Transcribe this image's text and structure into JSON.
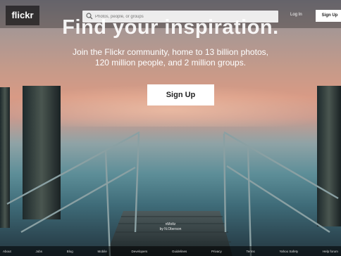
{
  "header": {
    "logo": "flickr",
    "search_placeholder": "Photos, people, or groups",
    "login_label": "Log In",
    "signup_label": "Sign Up"
  },
  "hero": {
    "title": "Find your inspiration.",
    "subtitle_line1": "Join the Flickr community, home to 13 billion photos,",
    "subtitle_line2": "120 million people, and 2 million groups.",
    "cta_label": "Sign Up"
  },
  "photo_credit": {
    "title": "nMoltz",
    "author": "by N.Oberson"
  },
  "footer": {
    "links": [
      "About",
      "Jobs",
      "Blog",
      "Mobile",
      "Developers",
      "Guidelines",
      "Privacy",
      "Terms",
      "Yahoo Safety",
      "Help forum"
    ]
  },
  "colors": {
    "header_bg": "#000000",
    "cta_bg": "#ffffff"
  }
}
